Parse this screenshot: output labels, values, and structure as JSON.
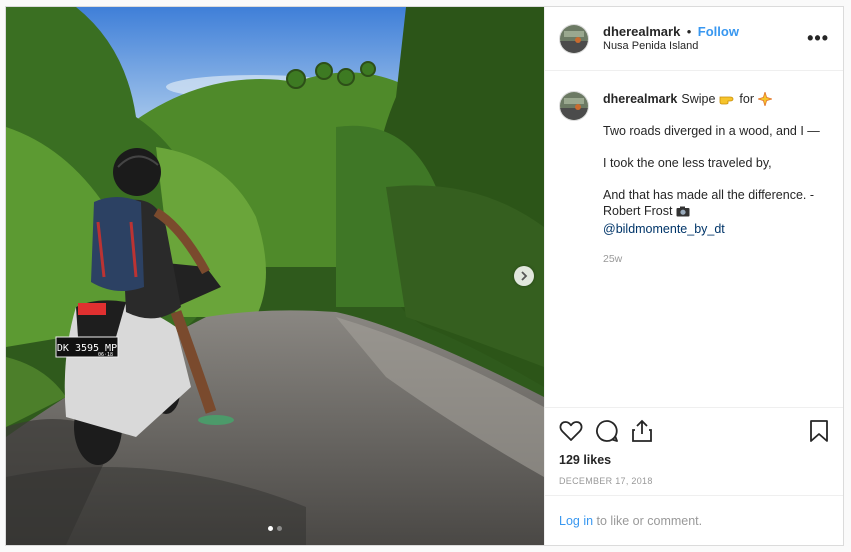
{
  "header": {
    "username": "dherealmark",
    "separator": "•",
    "follow_label": "Follow",
    "location": "Nusa Penida Island",
    "more_label": "•••"
  },
  "photo": {
    "plate": "DK 3595 MP",
    "plate_sub": "06·18",
    "carousel_position": 1,
    "carousel_count": 2
  },
  "caption": {
    "username": "dherealmark",
    "intro": "Swipe",
    "intro_for": "for",
    "line1": "Two roads diverged in a wood, and I —",
    "line2": "I took the one less traveled by,",
    "line3": "And that has made all the difference. - Robert Frost",
    "mention": "@bildmomente_by_dt",
    "time_ago": "25w"
  },
  "actions": {
    "likes": "129 likes",
    "date": "DECEMBER 17, 2018"
  },
  "login": {
    "link": "Log in",
    "rest": " to like or comment."
  },
  "icons": [
    "heart-icon",
    "comment-icon",
    "share-icon",
    "bookmark-icon",
    "point-right-emoji",
    "sparkle-emoji",
    "camera-emoji",
    "chevron-right-icon"
  ],
  "colors": {
    "accent": "#3897f0",
    "mention": "#003569",
    "muted": "#999999"
  }
}
